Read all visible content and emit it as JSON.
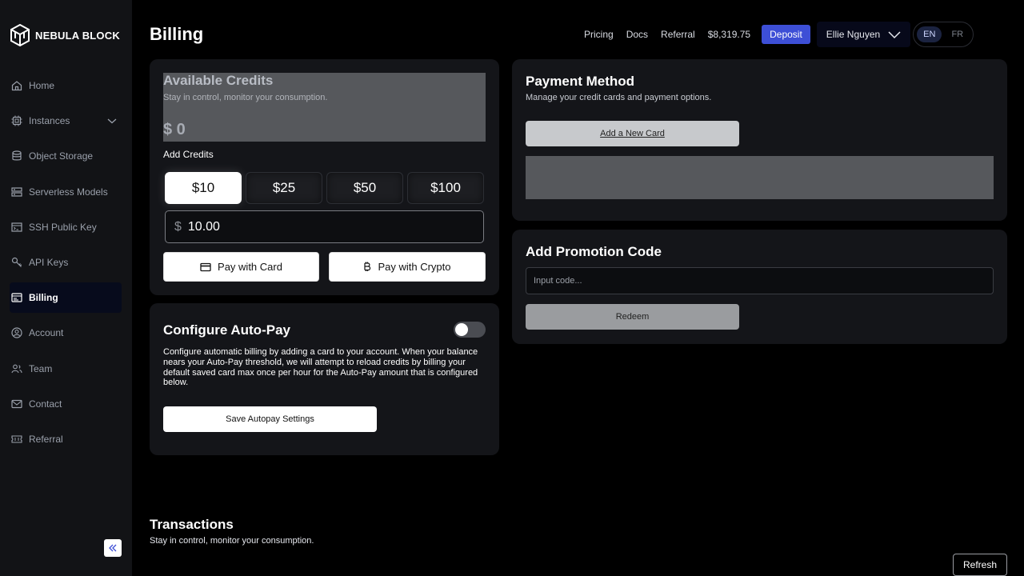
{
  "brand": {
    "name": "NEBULA BLOCK"
  },
  "sidebar": {
    "items": [
      {
        "label": "Home",
        "icon": "home-icon"
      },
      {
        "label": "Instances",
        "icon": "chip-icon"
      },
      {
        "label": "Object Storage",
        "icon": "database-icon"
      },
      {
        "label": "Serverless Models",
        "icon": "server-icon"
      },
      {
        "label": "SSH Public Key",
        "icon": "terminal-icon"
      },
      {
        "label": "API Keys",
        "icon": "key-icon"
      },
      {
        "label": "Billing",
        "icon": "billing-icon",
        "active": true
      },
      {
        "label": "Account",
        "icon": "user-circle-icon"
      },
      {
        "label": "Team",
        "icon": "team-icon"
      },
      {
        "label": "Contact",
        "icon": "mail-icon"
      },
      {
        "label": "Referral",
        "icon": "ticket-icon"
      }
    ]
  },
  "header": {
    "title": "Billing",
    "links": {
      "pricing": "Pricing",
      "docs": "Docs",
      "referral": "Referral"
    },
    "balance": "$8,319.75",
    "deposit": "Deposit",
    "user": "Ellie Nguyen",
    "lang": {
      "en": "EN",
      "fr": "FR",
      "selected": "EN"
    }
  },
  "credits": {
    "title": "Available Credits",
    "subtitle": "Stay in control, monitor your consumption.",
    "amount": "$ 0",
    "add_label": "Add Credits",
    "options": [
      "$10",
      "$25",
      "$50",
      "$100"
    ],
    "selected": "$10",
    "currency_symbol": "$",
    "amount_value": "10.00",
    "pay_card": "Pay with Card",
    "pay_crypto": "Pay with Crypto"
  },
  "autopay": {
    "title": "Configure Auto-Pay",
    "enabled": false,
    "description": "Configure automatic billing by adding a card to your account. When your balance nears your Auto-Pay threshold, we will attempt to reload credits by billing your default saved card max once per hour for the Auto-Pay amount that is configured below.",
    "save": "Save Autopay Settings"
  },
  "payment": {
    "title": "Payment Method",
    "subtitle": "Manage your credit cards and payment options.",
    "add_card": "Add a New Card"
  },
  "promo": {
    "title": "Add Promotion Code",
    "placeholder": "Input code...",
    "redeem": "Redeem"
  },
  "transactions": {
    "title": "Transactions",
    "subtitle": "Stay in control, monitor your consumption.",
    "refresh": "Refresh"
  },
  "colors": {
    "accent": "#3d4fd6",
    "sidebar_bg": "#121316",
    "card_bg": "#141519"
  }
}
